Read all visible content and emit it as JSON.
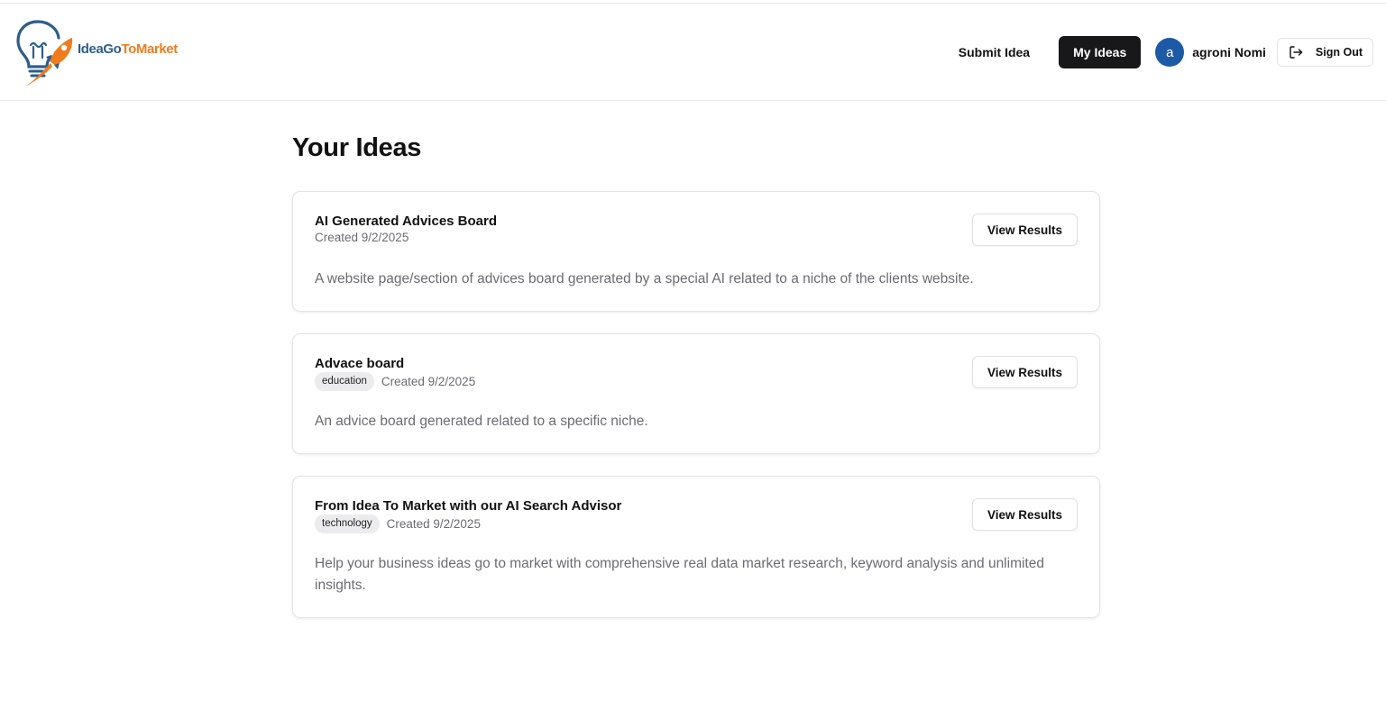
{
  "brand": {
    "name_part1": "IdeaGo",
    "name_part2": "ToMarket",
    "colors": {
      "blue": "#2c5f8a",
      "orange": "#f07b1d"
    }
  },
  "nav": {
    "submit_label": "Submit Idea",
    "my_ideas_label": "My Ideas",
    "avatar_initial": "a",
    "username": "agroni Nomi",
    "signout_label": "Sign Out"
  },
  "main": {
    "title": "Your Ideas",
    "ideas": [
      {
        "title": "AI Generated Advices Board",
        "tag": "",
        "created": "Created 9/2/2025",
        "description": "A website page/section of advices board generated by a special AI related to a niche of the clients website.",
        "button": "View Results"
      },
      {
        "title": "Advace board",
        "tag": "education",
        "created": "Created 9/2/2025",
        "description": "An advice board generated related to a specific niche.",
        "button": "View Results"
      },
      {
        "title": "From Idea To Market with our AI Search Advisor",
        "tag": "technology",
        "created": "Created 9/2/2025",
        "description": "Help your business ideas go to market with comprehensive real data market research, keyword analysis and unlimited insights.",
        "button": "View Results"
      }
    ]
  },
  "icons": {
    "logo": "lightbulb-rocket-icon",
    "signout": "sign-out-icon"
  },
  "colors": {
    "active_nav_bg": "#18181b",
    "avatar_bg": "#1d5aa6",
    "muted_text": "#6b6b73",
    "border": "#e4e4e7"
  }
}
